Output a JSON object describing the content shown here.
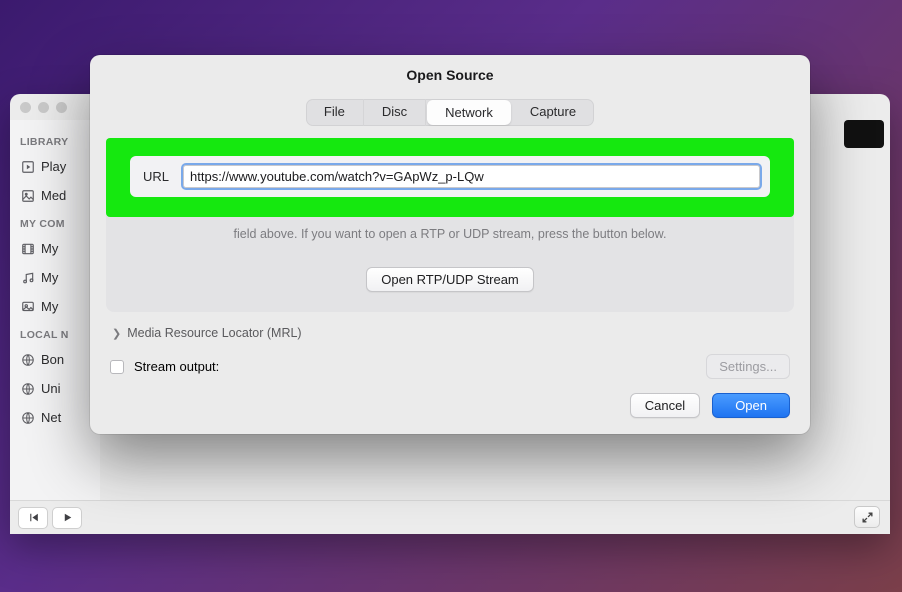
{
  "bg": {
    "sections": {
      "library": {
        "head": "LIBRARY",
        "items": [
          "Play",
          "Med"
        ]
      },
      "mycom": {
        "head": "MY COM",
        "items": [
          "My",
          "My",
          "My"
        ]
      },
      "localn": {
        "head": "LOCAL N",
        "items": [
          "Bon",
          "Uni",
          "Net"
        ]
      }
    }
  },
  "dialog": {
    "title": "Open Source",
    "tabs": {
      "file": "File",
      "disc": "Disc",
      "network": "Network",
      "capture": "Capture"
    },
    "url_label": "URL",
    "url_value": "https://www.youtube.com/watch?v=GApWz_p-LQw",
    "hint_line": "field above. If you want to open a RTP or UDP stream, press the button below.",
    "rtp_button": "Open RTP/UDP Stream",
    "mrl_label": "Media Resource Locator (MRL)",
    "stream_output_label": "Stream output:",
    "settings_label": "Settings...",
    "cancel_label": "Cancel",
    "open_label": "Open"
  }
}
